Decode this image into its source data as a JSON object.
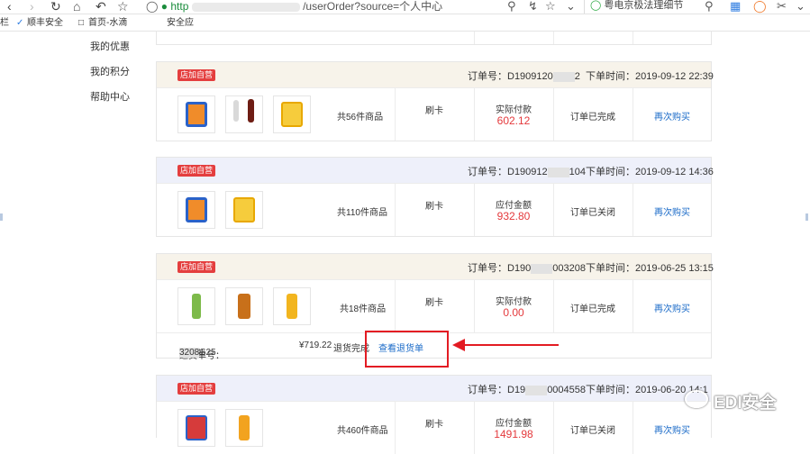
{
  "browser": {
    "url_scheme": "http",
    "url_path": "/userOrder?source=个人中心",
    "search_text": "粤电京极法理细节",
    "bookmarks": [
      "栏",
      "顺丰安全",
      "首页-水滴",
      "安全应"
    ]
  },
  "sidebar": {
    "items": [
      {
        "label": "我的优惠"
      },
      {
        "label": "我的积分"
      },
      {
        "label": "帮助中心"
      }
    ]
  },
  "orders": [
    {
      "tag": "店加自营",
      "order_no_label": "订单号：",
      "order_no_pre": "D1909120",
      "order_no_post": "2",
      "time_label": "下单时间：",
      "time": "2019-09-12 22:39",
      "count": "共56件商品",
      "payment": "刷卡",
      "amount_label": "实际付款",
      "amount": "602.12",
      "status": "订单已完成",
      "rebuy": "再次购买"
    },
    {
      "tag": "店加自营",
      "order_no_label": "订单号：",
      "order_no_pre": "D190912",
      "order_no_post": "104",
      "time_label": "下单时间：",
      "time": "2019-09-12 14:36",
      "count": "共110件商品",
      "payment": "刷卡",
      "amount_label": "应付金额",
      "amount": "932.80",
      "status": "订单已关闭",
      "rebuy": "再次购买"
    },
    {
      "tag": "店加自营",
      "order_no_label": "订单号：",
      "order_no_pre": "D190",
      "order_no_post": "003208",
      "time_label": "下单时间：",
      "time": "2019-06-25 13:15",
      "count": "共18件商品",
      "payment": "刷卡",
      "amount_label": "实际付款",
      "amount": "0.00",
      "status": "订单已完成",
      "rebuy": "再次购买",
      "refund": {
        "label": "退货单号：",
        "no_pre": "R190625",
        "no_post": "32081",
        "amount": "¥719.22",
        "status": "退货完成",
        "link": "查看退货单"
      }
    },
    {
      "tag": "店加自营",
      "order_no_label": "订单号：",
      "order_no_pre": "D19",
      "order_no_post": "0004558",
      "time_label": "下单时间：",
      "time": "2019-06-20 14:1",
      "count": "共460件商品",
      "payment": "刷卡",
      "amount_label": "应付金额",
      "amount": "1491.98",
      "status": "订单已关闭",
      "rebuy": "再次购买"
    }
  ],
  "watermark": "EDI安全",
  "colors": {
    "accent_red": "#e4393c",
    "link_blue": "#1b6bc8",
    "annotation_red": "#e31b23",
    "header_beige": "#f7f3ea",
    "header_blue": "#eef0fa"
  }
}
